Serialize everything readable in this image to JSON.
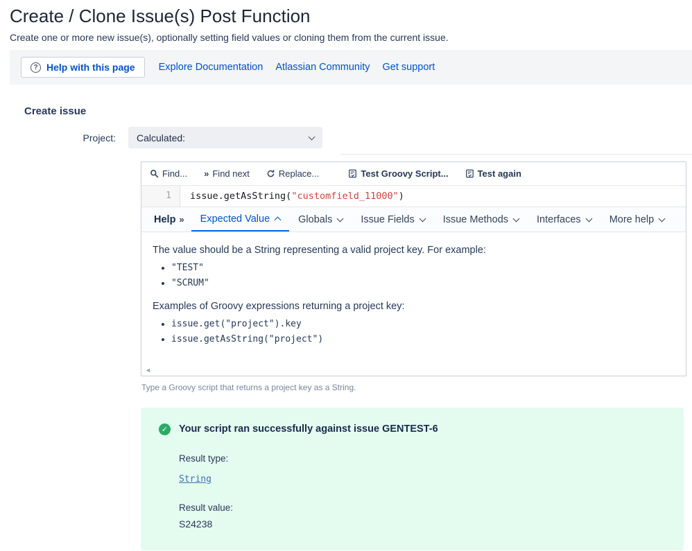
{
  "page": {
    "title": "Create / Clone Issue(s) Post Function",
    "subtitle": "Create one or more new issue(s), optionally setting field values or cloning them from the current issue."
  },
  "help_bar": {
    "help_button_label": "Help with this page",
    "links": [
      "Explore Documentation",
      "Atlassian Community",
      "Get support"
    ]
  },
  "form": {
    "section_title": "Create issue",
    "project_label": "Project:",
    "project_value": "Calculated:"
  },
  "editor": {
    "toolbar": {
      "find": "Find...",
      "find_next": "Find next",
      "replace": "Replace...",
      "test_script": "Test Groovy Script...",
      "test_again": "Test again"
    },
    "line_number": "1",
    "code": {
      "pre": "issue.getAsString(",
      "string": "\"customfield_11000\"",
      "post": ")"
    },
    "help_tabs": {
      "help_label": "Help",
      "tabs": [
        {
          "label": "Expected Value",
          "expanded": true
        },
        {
          "label": "Globals",
          "expanded": false
        },
        {
          "label": "Issue Fields",
          "expanded": false
        },
        {
          "label": "Issue Methods",
          "expanded": false
        },
        {
          "label": "Interfaces",
          "expanded": false
        },
        {
          "label": "More help",
          "expanded": false
        }
      ]
    },
    "help_content": {
      "para1": "The value should be a String representing a valid project key. For example:",
      "examples1": [
        "\"TEST\"",
        "\"SCRUM\""
      ],
      "para2": "Examples of Groovy expressions returning a project key:",
      "examples2": [
        "issue.get(\"project\").key",
        "issue.getAsString(\"project\")"
      ]
    }
  },
  "field_hint": "Type a Groovy script that returns a project key as a String.",
  "result_panel": {
    "title": "Your script ran successfully against issue GENTEST-6",
    "result_type_label": "Result type:",
    "result_type": "String",
    "result_value_label": "Result value:",
    "result_value": "S24238"
  },
  "icons": {
    "question": "?",
    "double_chevron": "»",
    "scroll_left": "◄",
    "check": "✓"
  },
  "colors": {
    "accent_blue": "#0052CC",
    "success_bg": "#E3FCEF",
    "success_green": "#2BAA66",
    "code_string_red": "#D04437",
    "help_bar_bg": "#F4F5F7"
  }
}
